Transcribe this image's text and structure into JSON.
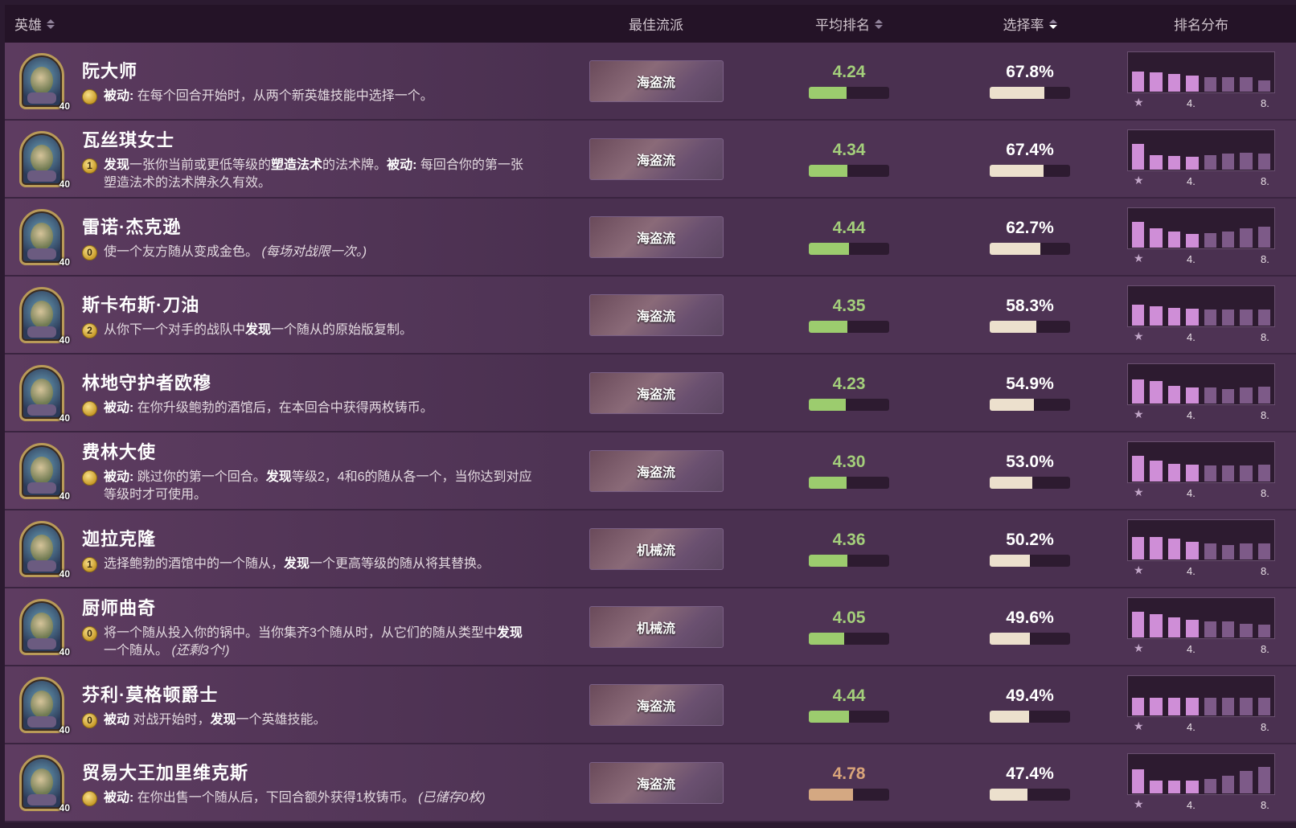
{
  "header": {
    "hero": "英雄",
    "comp": "最佳流派",
    "avg": "平均排名",
    "pick": "选择率",
    "dist": "排名分布"
  },
  "dist_ticks": [
    "4.",
    "8."
  ],
  "colors": {
    "good": "#9ccc6e",
    "warn": "#d4a882",
    "pick": "#ece0cd",
    "dist": "#cf8ed7"
  },
  "heroes": [
    {
      "name": "阮大师",
      "coin": "",
      "desc_html": "<b>被动:</b> 在每个回合开始时，从两个新英雄技能中选择一个。",
      "level": "40",
      "comp": "海盗流",
      "avg": "4.24",
      "avg_fraction": 0.47,
      "pick": "67.8%",
      "pick_fraction": 0.68,
      "dist": [
        0.62,
        0.58,
        0.55,
        0.5,
        0.45,
        0.44,
        0.43,
        0.35
      ]
    },
    {
      "name": "瓦丝琪女士",
      "coin": "1",
      "desc_html": "<b>发现</b>一张你当前或更低等级的<b>塑造法术</b>的法术牌。<b>被动:</b> 每回合你的第一张塑造法术的法术牌永久有效。",
      "level": "40",
      "comp": "海盗流",
      "avg": "4.34",
      "avg_fraction": 0.48,
      "pick": "67.4%",
      "pick_fraction": 0.67,
      "dist": [
        0.8,
        0.45,
        0.42,
        0.4,
        0.45,
        0.48,
        0.52,
        0.5
      ]
    },
    {
      "name": "雷诺·杰克逊",
      "coin": "0",
      "desc_html": "使一个友方随从变成金色。 <i>(每场对战限一次。)</i>",
      "level": "40",
      "comp": "海盗流",
      "avg": "4.44",
      "avg_fraction": 0.5,
      "pick": "62.7%",
      "pick_fraction": 0.63,
      "dist": [
        0.78,
        0.58,
        0.5,
        0.42,
        0.45,
        0.5,
        0.58,
        0.65
      ]
    },
    {
      "name": "斯卡布斯·刀油",
      "coin": "2",
      "desc_html": "从你下一个对手的战队中<b>发现</b>一个随从的原始版复制。",
      "level": "40",
      "comp": "海盗流",
      "avg": "4.35",
      "avg_fraction": 0.48,
      "pick": "58.3%",
      "pick_fraction": 0.58,
      "dist": [
        0.65,
        0.58,
        0.55,
        0.52,
        0.5,
        0.48,
        0.48,
        0.48
      ]
    },
    {
      "name": "林地守护者欧穆",
      "coin": "",
      "desc_html": "<b>被动:</b> 在你升级鲍勃的酒馆后，在本回合中获得两枚铸币。",
      "level": "40",
      "comp": "海盗流",
      "avg": "4.23",
      "avg_fraction": 0.46,
      "pick": "54.9%",
      "pick_fraction": 0.55,
      "dist": [
        0.75,
        0.68,
        0.55,
        0.5,
        0.48,
        0.45,
        0.48,
        0.52
      ]
    },
    {
      "name": "费林大使",
      "coin": "",
      "desc_html": "<b>被动:</b> 跳过你的第一个回合。<b>发现</b>等级2，4和6的随从各一个，当你达到对应等级时才可使用。",
      "level": "40",
      "comp": "海盗流",
      "avg": "4.30",
      "avg_fraction": 0.47,
      "pick": "53.0%",
      "pick_fraction": 0.53,
      "dist": [
        0.8,
        0.65,
        0.55,
        0.52,
        0.48,
        0.48,
        0.5,
        0.52
      ]
    },
    {
      "name": "迦拉克隆",
      "coin": "1",
      "desc_html": "选择鲍勃的酒馆中的一个随从，<b>发现</b>一个更高等级的随从将其替换。",
      "level": "40",
      "comp": "机械流",
      "avg": "4.36",
      "avg_fraction": 0.48,
      "pick": "50.2%",
      "pick_fraction": 0.5,
      "dist": [
        0.68,
        0.68,
        0.65,
        0.55,
        0.48,
        0.45,
        0.48,
        0.5
      ]
    },
    {
      "name": "厨师曲奇",
      "coin": "0",
      "desc_html": "将一个随从投入你的锅中。当你集齐3个随从时，从它们的随从类型中<b>发现</b>一个随从。 <i>(还剩3个!)</i>",
      "level": "40",
      "comp": "机械流",
      "avg": "4.05",
      "avg_fraction": 0.44,
      "pick": "49.6%",
      "pick_fraction": 0.5,
      "dist": [
        0.8,
        0.72,
        0.62,
        0.55,
        0.5,
        0.48,
        0.42,
        0.38
      ]
    },
    {
      "name": "芬利·莫格顿爵士",
      "coin": "0",
      "desc_html": "<b>被动</b> 对战开始时，<b>发现</b>一个英雄技能。",
      "level": "40",
      "comp": "海盗流",
      "avg": "4.44",
      "avg_fraction": 0.5,
      "pick": "49.4%",
      "pick_fraction": 0.49,
      "dist": [
        0.55,
        0.55,
        0.55,
        0.55,
        0.55,
        0.55,
        0.55,
        0.55
      ]
    },
    {
      "name": "贸易大王加里维克斯",
      "coin": "",
      "desc_html": "<b>被动:</b> 在你出售一个随从后，下回合额外获得1枚铸币。 <i>(已储存0枚)</i>",
      "level": "40",
      "comp": "海盗流",
      "avg": "4.78",
      "avg_fraction": 0.55,
      "pick": "47.4%",
      "pick_fraction": 0.47,
      "dist": [
        0.75,
        0.38,
        0.38,
        0.4,
        0.45,
        0.55,
        0.7,
        0.82
      ],
      "avg_warn": true
    }
  ]
}
